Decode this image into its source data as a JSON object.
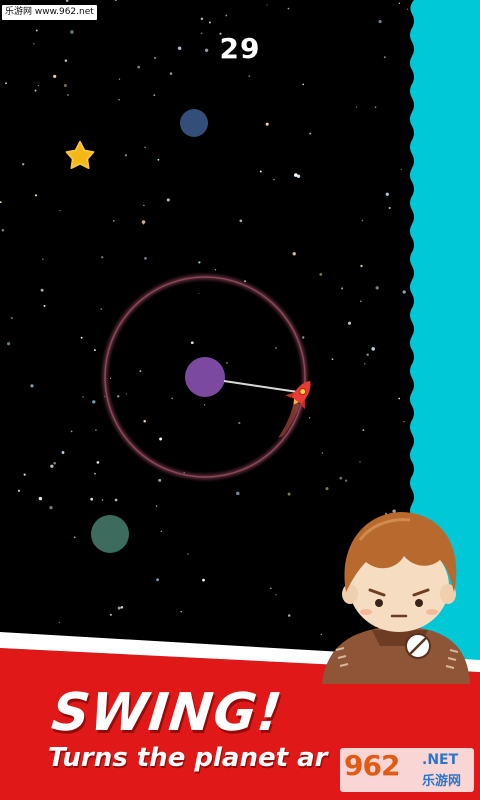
{
  "watermark": {
    "site_label": "乐游网 www.962.net"
  },
  "hud": {
    "score": "29"
  },
  "promo": {
    "headline": "SWING!",
    "subtitle": "Turns the planet ar"
  },
  "logo": {
    "brand_number": "962",
    "brand_suffix": ".NET",
    "brand_cn": "乐游网"
  },
  "colors": {
    "space_background": "#000000",
    "cyan_wall": "#00c8d6",
    "banner_red": "#e01818",
    "center_planet": "#7b4aa0",
    "blue_planet": "#344e7a",
    "green_planet": "#3d6b5e",
    "star_collectible": "#f5b716",
    "rocket": "#e83c33",
    "orbit_ring": "#7a3c4c"
  },
  "icons": {
    "collectible": "star-icon",
    "player": "rocket-icon",
    "character_badge": "prohibited-sign-icon"
  }
}
